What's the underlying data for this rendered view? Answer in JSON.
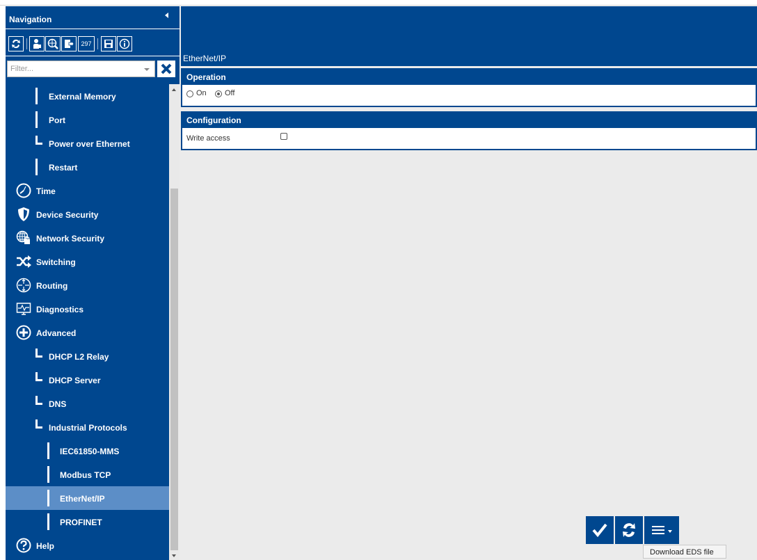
{
  "nav": {
    "header_title": "Navigation",
    "toolbar": {
      "count_badge": "297",
      "icons": [
        "reload-icon",
        "user-icon",
        "globe-search-icon",
        "logout-icon",
        "save-icon",
        "info-icon"
      ]
    },
    "filter": {
      "placeholder": "Filter..."
    },
    "items": [
      {
        "label": "External Memory"
      },
      {
        "label": "Port"
      },
      {
        "label": "Power over Ethernet"
      },
      {
        "label": "Restart"
      },
      {
        "label": "Time",
        "icon": "clock-icon"
      },
      {
        "label": "Device Security",
        "icon": "shield-icon"
      },
      {
        "label": "Network Security",
        "icon": "globe-lock-icon"
      },
      {
        "label": "Switching",
        "icon": "shuffle-icon"
      },
      {
        "label": "Routing",
        "icon": "routing-icon"
      },
      {
        "label": "Diagnostics",
        "icon": "monitor-pulse-icon"
      },
      {
        "label": "Advanced",
        "icon": "plus-circle-icon"
      },
      {
        "label": "DHCP L2 Relay"
      },
      {
        "label": "DHCP Server"
      },
      {
        "label": "DNS"
      },
      {
        "label": "Industrial Protocols"
      },
      {
        "label": "IEC61850-MMS"
      },
      {
        "label": "Modbus TCP"
      },
      {
        "label": "EtherNet/IP",
        "active": true
      },
      {
        "label": "PROFINET"
      },
      {
        "label": "Help",
        "icon": "help-icon"
      }
    ]
  },
  "page": {
    "title": "EtherNet/IP",
    "operation": {
      "heading": "Operation",
      "options": [
        "On",
        "Off"
      ],
      "selected": "Off"
    },
    "configuration": {
      "heading": "Configuration",
      "write_access_label": "Write access",
      "write_access_checked": false
    }
  },
  "actions": {
    "icons": [
      "check-icon",
      "reload-icon",
      "menu-icon"
    ],
    "dropdown_item": "Download EDS file"
  },
  "colors": {
    "primary": "#00478f",
    "active_item": "#5c8ec7",
    "content_bg": "#ebebeb"
  }
}
